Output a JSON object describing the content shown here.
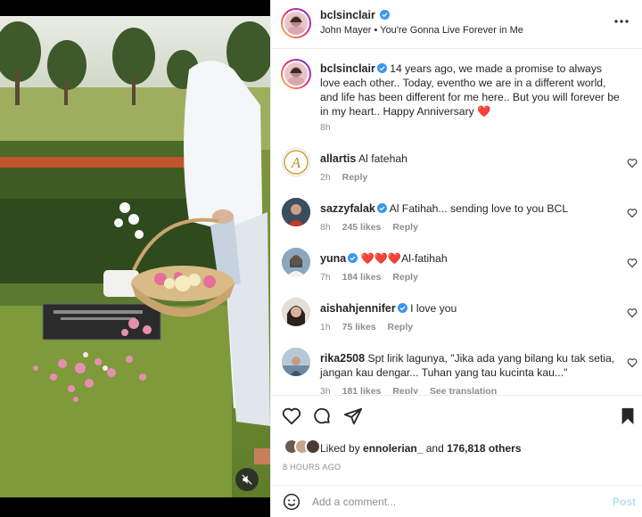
{
  "header": {
    "username": "bclsinclair",
    "audio": "John Mayer • You're Gonna Live Forever in Me"
  },
  "caption": {
    "username": "bclsinclair",
    "text": "14 years ago, we made a promise to always love each other.. Today, eventho we are in a different world, and life has been different for me here.. But you will forever be in my heart.. Happy Anniversary",
    "emoji": "❤️",
    "time": "8h"
  },
  "comments": [
    {
      "username": "allartis",
      "verified": false,
      "text": "Al fatehah",
      "time": "2h",
      "likes": "",
      "reply": "Reply"
    },
    {
      "username": "sazzyfalak",
      "verified": true,
      "text": "Al Fatihah... sending love to you BCL",
      "time": "8h",
      "likes": "245 likes",
      "reply": "Reply"
    },
    {
      "username": "yuna",
      "verified": true,
      "emoji": "❤️❤️❤️",
      "text": "Al-fatihah",
      "time": "7h",
      "likes": "184 likes",
      "reply": "Reply"
    },
    {
      "username": "aishahjennifer",
      "verified": true,
      "text": "I love you",
      "time": "1h",
      "likes": "75 likes",
      "reply": "Reply"
    },
    {
      "username": "rika2508",
      "verified": false,
      "text": "Spt lirik lagunya, \"Jika ada yang bilang ku tak setia, jangan kau dengar... Tuhan yang tau kucinta kau...\"",
      "time": "3h",
      "likes": "181 likes",
      "reply": "Reply",
      "see_translation": "See translation"
    }
  ],
  "likes": {
    "prefix": "Liked by",
    "user": "ennolerian_",
    "conj": "and",
    "others": "176,818 others"
  },
  "timestamp": "8 HOURS AGO",
  "add_comment": {
    "placeholder": "Add a comment...",
    "post_label": "Post"
  },
  "colors": {
    "verified": "#3897f0",
    "heart_red": "#ed4956",
    "post_disabled": "#b2dffc"
  }
}
